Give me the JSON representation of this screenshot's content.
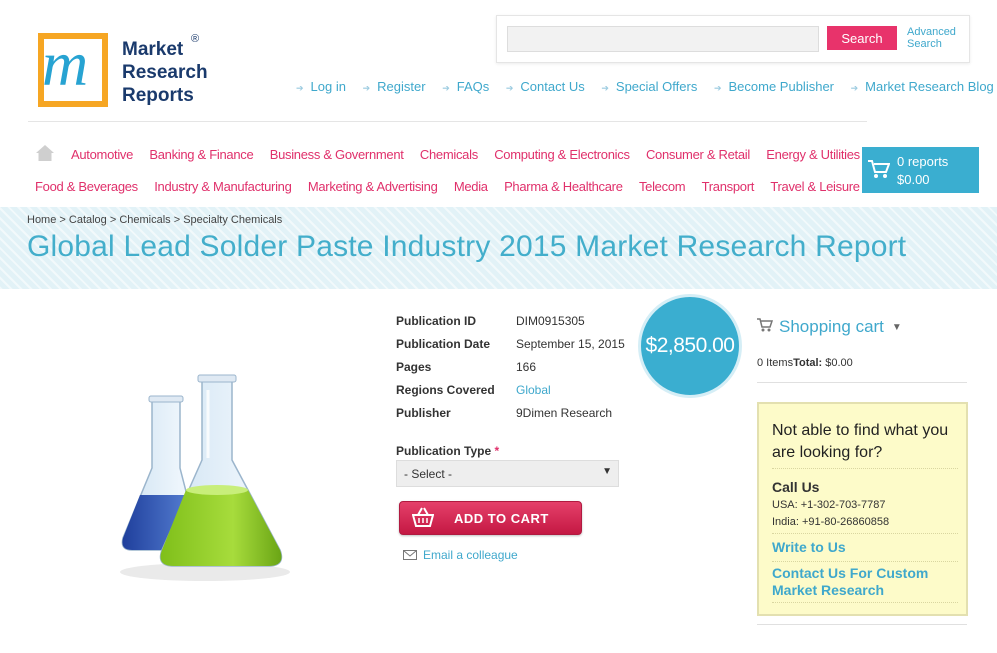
{
  "logo": {
    "line1": "Market",
    "line2": "Research",
    "line3": "Reports",
    "reg": "®"
  },
  "search": {
    "placeholder": "",
    "button": "Search",
    "advanced_line1": "Advanced",
    "advanced_line2": "Search"
  },
  "top_links": [
    "Log in",
    "Register",
    "FAQs",
    "Contact Us",
    "Special Offers",
    "Become Publisher",
    "Market Research Blog"
  ],
  "nav": {
    "row1": [
      "Automotive",
      "Banking & Finance",
      "Business & Government",
      "Chemicals",
      "Computing & Electronics",
      "Consumer & Retail",
      "Energy & Utilities"
    ],
    "row2": [
      "Food & Beverages",
      "Industry & Manufacturing",
      "Marketing & Advertising",
      "Media",
      "Pharma & Healthcare",
      "Telecom",
      "Transport",
      "Travel & Leisure"
    ]
  },
  "cart_box": {
    "reports": "0 reports",
    "total": "$0.00"
  },
  "breadcrumb": "Home > Catalog > Chemicals > Specialty Chemicals",
  "title": "Global Lead Solder Paste Industry 2015 Market Research Report",
  "details": [
    {
      "label": "Publication ID",
      "value": "DIM0915305",
      "link": false
    },
    {
      "label": "Publication Date",
      "value": "September 15, 2015",
      "link": false
    },
    {
      "label": "Pages",
      "value": "166",
      "link": false
    },
    {
      "label": "Regions Covered",
      "value": "Global",
      "link": true
    },
    {
      "label": "Publisher",
      "value": "9Dimen Research",
      "link": false
    }
  ],
  "price": "$2,850.00",
  "publication_type": {
    "label": "Publication Type",
    "required": "*",
    "selected": "- Select -"
  },
  "add_to_cart": "ADD TO CART",
  "email_colleague": "Email a colleague",
  "sidebar": {
    "shopping_cart": "Shopping cart",
    "items": "0 Items",
    "total_label": "Total:",
    "total_value": " $0.00",
    "help_question": "Not able to find what you are looking for?",
    "call_us": "Call Us",
    "phone_usa": "USA: +1-302-703-7787",
    "phone_india": "India: +91-80-26860858",
    "write_to_us": "Write to Us",
    "custom_research": "Contact Us For Custom Market Research"
  },
  "colors": {
    "accent_blue": "#3aaed0",
    "accent_pink": "#e0306b",
    "logo_orange": "#f6a623",
    "help_bg": "#fdfbc9"
  }
}
